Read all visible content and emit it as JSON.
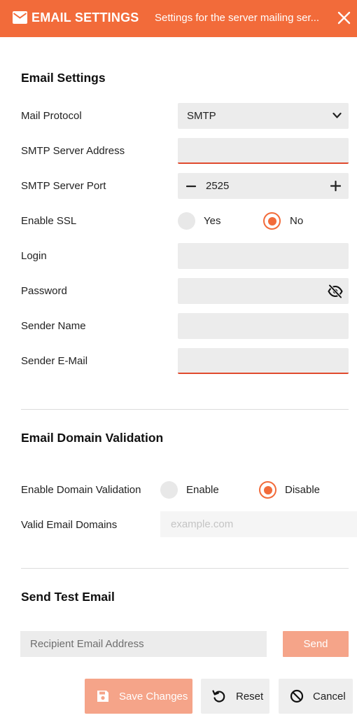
{
  "header": {
    "icon": "mail-icon",
    "title": "EMAIL SETTINGS",
    "subtitle": "Settings for the server mailing ser...",
    "accent": "#f26b3a"
  },
  "email_settings": {
    "title": "Email Settings",
    "mail_protocol": {
      "label": "Mail Protocol",
      "value": "SMTP"
    },
    "smtp_server_address": {
      "label": "SMTP Server Address",
      "value": ""
    },
    "smtp_server_port": {
      "label": "SMTP Server Port",
      "value": "2525"
    },
    "enable_ssl": {
      "label": "Enable SSL",
      "option_yes": "Yes",
      "option_no": "No",
      "selected": "No"
    },
    "login": {
      "label": "Login",
      "value": ""
    },
    "password": {
      "label": "Password",
      "value": ""
    },
    "sender_name": {
      "label": "Sender Name",
      "value": ""
    },
    "sender_email": {
      "label": "Sender E-Mail",
      "value": ""
    }
  },
  "domain_validation": {
    "title": "Email Domain Validation",
    "enable": {
      "label": "Enable Domain Validation",
      "option_enable": "Enable",
      "option_disable": "Disable",
      "selected": "Disable"
    },
    "valid_domains": {
      "label": "Valid Email Domains",
      "placeholder": "example.com",
      "value": ""
    }
  },
  "test_email": {
    "title": "Send Test Email",
    "recipient_placeholder": "Recipient Email Address",
    "send_label": "Send"
  },
  "footer": {
    "save_label": "Save Changes",
    "reset_label": "Reset",
    "cancel_label": "Cancel"
  },
  "colors": {
    "accent": "#f26b3a",
    "accent_disabled": "#f5a489",
    "error": "#e04a2e",
    "field_bg": "#ececec"
  }
}
